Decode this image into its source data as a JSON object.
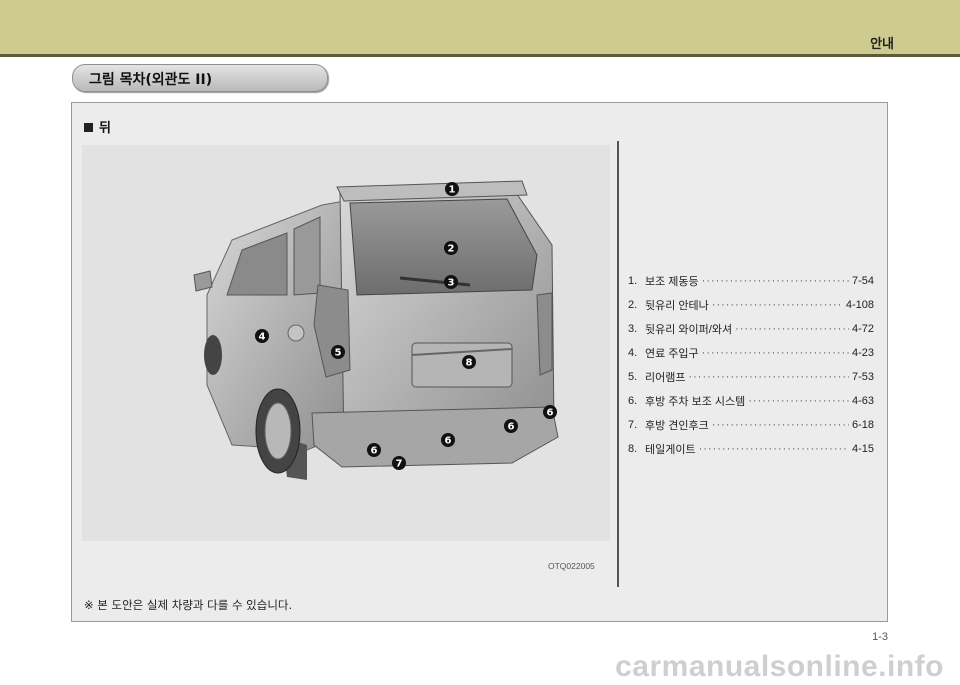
{
  "header": {
    "title": "안내"
  },
  "tab": {
    "label": "그림 목차(외관도 II)"
  },
  "section": {
    "label": "뒤"
  },
  "figure": {
    "code": "OTQ022005",
    "callouts": [
      "1",
      "2",
      "3",
      "4",
      "5",
      "8",
      "6",
      "6",
      "6",
      "6",
      "7"
    ]
  },
  "toc": [
    {
      "num": "1.",
      "title": "보조 제동등",
      "page": "7-54"
    },
    {
      "num": "2.",
      "title": "뒷유리 안테나",
      "page": "4-108"
    },
    {
      "num": "3.",
      "title": "뒷유리 와이퍼/와셔",
      "page": "4-72"
    },
    {
      "num": "4.",
      "title": "연료 주입구",
      "page": "4-23"
    },
    {
      "num": "5.",
      "title": "리어램프",
      "page": "7-53"
    },
    {
      "num": "6.",
      "title": "후방 주차 보조 시스템",
      "page": "4-63"
    },
    {
      "num": "7.",
      "title": "후방 견인후크",
      "page": "6-18"
    },
    {
      "num": "8.",
      "title": "테일게이트",
      "page": "4-15"
    }
  ],
  "note": "※ 본 도안은 실제 차량과 다를 수 있습니다.",
  "page_number": "1-3",
  "watermark": "carmanualsonline.info"
}
